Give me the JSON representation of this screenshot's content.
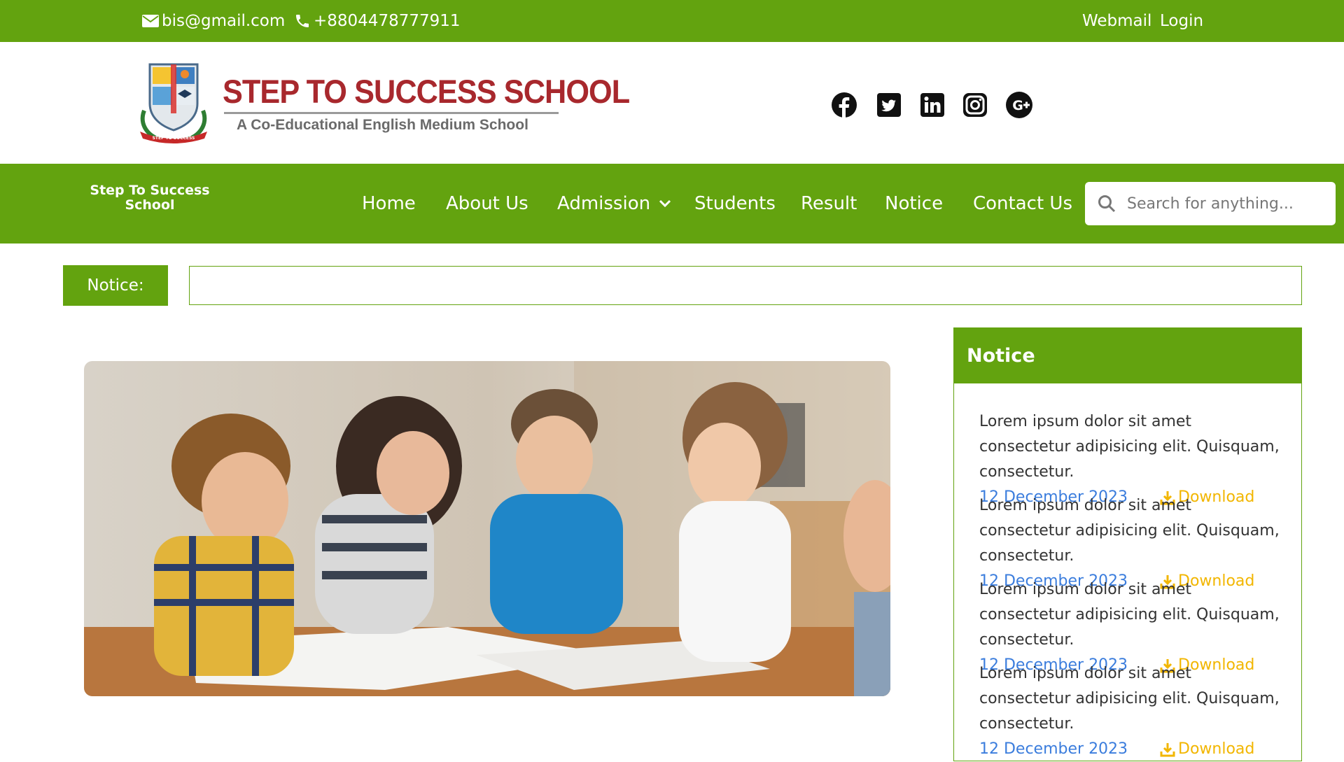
{
  "topbar": {
    "email": "bis@gmail.com",
    "phone": "+8804478777911",
    "webmail": "Webmail",
    "login": "Login"
  },
  "header": {
    "logo_title": "STEP TO SUCCESS SCHOOL",
    "logo_tagline": "A Co-Educational English Medium School",
    "social_icons": [
      "facebook-icon",
      "twitter-icon",
      "linkedin-icon",
      "instagram-icon",
      "google-plus-icon"
    ]
  },
  "nav": {
    "brand_line1": "Step To Success",
    "brand_line2": "School",
    "links": [
      "Home",
      "About Us",
      "Admission",
      "Students",
      "Result",
      "Notice",
      "Contact Us"
    ],
    "search_placeholder": "Search for anything..."
  },
  "ticker": {
    "label": "Notice:",
    "text": ""
  },
  "notice_panel": {
    "title": "Notice",
    "items": [
      {
        "text": "Lorem ipsum dolor sit amet consectetur adipisicing elit. Quisquam, consectetur.",
        "date": "12 December 2023",
        "download": "Download"
      },
      {
        "text": "Lorem ipsum dolor sit amet consectetur adipisicing elit. Quisquam, consectetur.",
        "date": "12 December 2023",
        "download": "Download"
      },
      {
        "text": "Lorem ipsum dolor sit amet consectetur adipisicing elit. Quisquam, consectetur.",
        "date": "12 December 2023",
        "download": "Download"
      },
      {
        "text": "Lorem ipsum dolor sit amet consectetur adipisicing elit. Quisquam, consectetur.",
        "date": "12 December 2023",
        "download": "Download"
      }
    ]
  },
  "colors": {
    "brand_green": "#63a30f",
    "logo_red": "#a8282d",
    "date_blue": "#3b7ddd",
    "download_yellow": "#f2b600"
  }
}
